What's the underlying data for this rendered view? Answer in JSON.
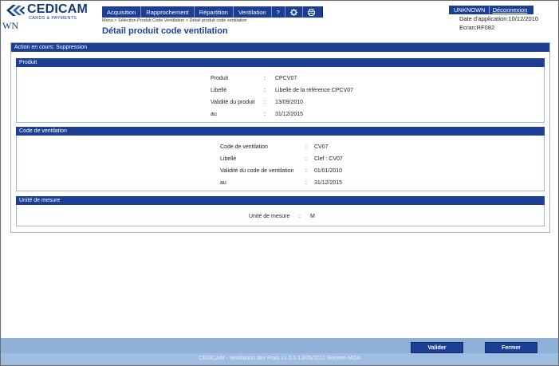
{
  "brand": {
    "name": "CEDICAM",
    "tagline": "CARDS & PAYMENTS",
    "app_code": "WN"
  },
  "menu": {
    "items": [
      {
        "label": "Acquisition"
      },
      {
        "label": "Rapprochement"
      },
      {
        "label": "Répartition"
      },
      {
        "label": "Ventilation"
      },
      {
        "label": "?"
      }
    ],
    "icons": [
      "gear-icon",
      "printer-icon"
    ]
  },
  "breadcrumb": "Menu > Sélection Produit Code Ventilation > Détail produit code ventilation",
  "page_title": "Détail produit code ventilation",
  "user": {
    "name": "UNKNOWN",
    "logout_label": "Déconnexion",
    "app_date": "Date d'application:10/12/2010",
    "screen": "Ecran:RF082"
  },
  "action": "Action en cours: Suppression",
  "produit": {
    "title": "Produit",
    "fields": [
      {
        "label": "Produit",
        "sep": ":",
        "value": "CPCV07"
      },
      {
        "label": "Libellé",
        "sep": ":",
        "value": "Libellé de la référence CPCV07"
      },
      {
        "label": "Validité du produit",
        "sep": ":",
        "value": "13/09/2010"
      },
      {
        "label": "au",
        "sep": ":",
        "value": "31/12/2015"
      }
    ]
  },
  "code": {
    "title": "Code de ventilation",
    "fields": [
      {
        "label": "Code de ventilation",
        "sep": ":",
        "value": "CV07"
      },
      {
        "label": "Libellé",
        "sep": ":",
        "value": "Clef : CV07"
      },
      {
        "label": "Validité du code de ventilation",
        "sep": ":",
        "value": "01/01/2010"
      },
      {
        "label": "au",
        "sep": ":",
        "value": "31/12/2015"
      }
    ]
  },
  "unite": {
    "title": "Unité de mesure",
    "field": {
      "label": "Unité de mesure",
      "sep": ":",
      "value": "M"
    }
  },
  "buttons": {
    "valider": "Valider",
    "fermer": "Fermer"
  },
  "footer": "CEDICAM - Ventilation des Frais v1.5.5 13/05/2011 Recette MOA"
}
